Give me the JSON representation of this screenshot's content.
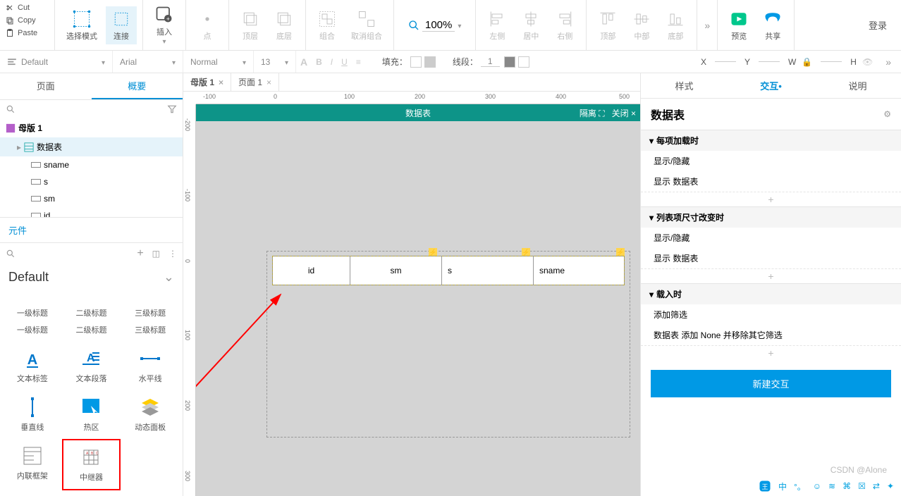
{
  "clipboard": {
    "cut": "Cut",
    "copy": "Copy",
    "paste": "Paste"
  },
  "toolbar": {
    "select_mode": "选择模式",
    "connect": "连接",
    "insert": "插入",
    "point": "点",
    "top_layer": "顶层",
    "bottom_layer": "底层",
    "group": "组合",
    "ungroup": "取消组合",
    "zoom": "100%",
    "left": "左侧",
    "center_h": "居中",
    "right": "右侧",
    "top": "顶部",
    "center_v": "中部",
    "bottom": "底部",
    "preview": "预览",
    "share": "共享",
    "login": "登录"
  },
  "format_bar": {
    "style_label": "Default",
    "font": "Arial",
    "weight": "Normal",
    "size": "13",
    "fill_label": "填充：",
    "line_label": "线段：",
    "line_width": "1",
    "x_label": "X",
    "y_label": "Y",
    "w_label": "W",
    "h_label": "H"
  },
  "left_panel": {
    "tab_pages": "页面",
    "tab_outline": "概要",
    "outline": {
      "master1": "母版 1",
      "repeater": "数据表",
      "children": [
        "sname",
        "s",
        "sm",
        "id"
      ]
    },
    "components_header": "元件",
    "library": "Default",
    "widgets": [
      "一级标题",
      "二级标题",
      "三级标题",
      "文本标签",
      "文本段落",
      "水平线",
      "垂直线",
      "热区",
      "动态面板",
      "内联框架",
      "中继器"
    ]
  },
  "canvas": {
    "tabs": [
      {
        "label": "母版 1"
      },
      {
        "label": "页面 1"
      }
    ],
    "ruler_h": [
      "-100",
      "0",
      "100",
      "200",
      "300",
      "400",
      "500"
    ],
    "ruler_v": [
      "-200",
      "-100",
      "0",
      "100",
      "200",
      "300"
    ],
    "iso_title": "数据表",
    "iso_isolate": "隔离",
    "iso_close": "关闭",
    "cells": [
      "id",
      "sm",
      "s",
      "sname"
    ]
  },
  "right_panel": {
    "tab_style": "样式",
    "tab_interact": "交互",
    "tab_notes": "说明",
    "title": "数据表",
    "sec1": {
      "head": "每项加载时",
      "items": [
        "显示/隐藏",
        "显示 数据表"
      ]
    },
    "sec2": {
      "head": "列表项尺寸改变时",
      "items": [
        "显示/隐藏",
        "显示 数据表"
      ]
    },
    "sec3": {
      "head": "载入时",
      "items": [
        "添加筛选",
        "数据表 添加 None 并移除其它筛选"
      ]
    },
    "new_btn": "新建交互"
  },
  "watermark": "CSDN @Alone",
  "bottom_chars": [
    "中",
    "°。",
    "☺",
    "≋",
    "⌘",
    "☒",
    "⇄",
    "✦"
  ]
}
